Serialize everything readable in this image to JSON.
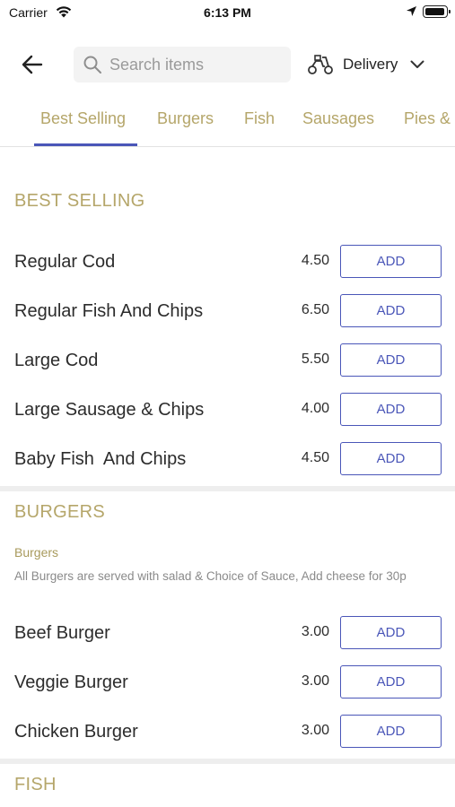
{
  "status": {
    "carrier": "Carrier",
    "time": "6:13 PM"
  },
  "header": {
    "search_placeholder": "Search items",
    "delivery_label": "Delivery"
  },
  "tabs": [
    "Best Selling",
    "Burgers",
    "Fish",
    "Sausages",
    "Pies &"
  ],
  "active_tab": "Best Selling",
  "colors": {
    "accent": "#4a56b8",
    "section_title": "#b5a66a"
  },
  "add_label": "ADD",
  "sections": {
    "best_selling": {
      "title": "BEST SELLING",
      "items": [
        {
          "name": "Regular Cod",
          "price": "4.50"
        },
        {
          "name": "Regular Fish And Chips",
          "price": "6.50"
        },
        {
          "name": "Large Cod",
          "price": "5.50"
        },
        {
          "name": "Large Sausage & Chips",
          "price": "4.00"
        },
        {
          "name": "Baby Fish  And Chips",
          "price": "4.50"
        }
      ]
    },
    "burgers": {
      "title": "BURGERS",
      "subtitle": "Burgers",
      "description": "All Burgers are served with salad & Choice of Sauce, Add cheese for 30p",
      "items": [
        {
          "name": "Beef Burger",
          "price": "3.00"
        },
        {
          "name": "Veggie Burger",
          "price": "3.00"
        },
        {
          "name": "Chicken Burger",
          "price": "3.00"
        }
      ]
    },
    "fish": {
      "title": "FISH"
    }
  }
}
